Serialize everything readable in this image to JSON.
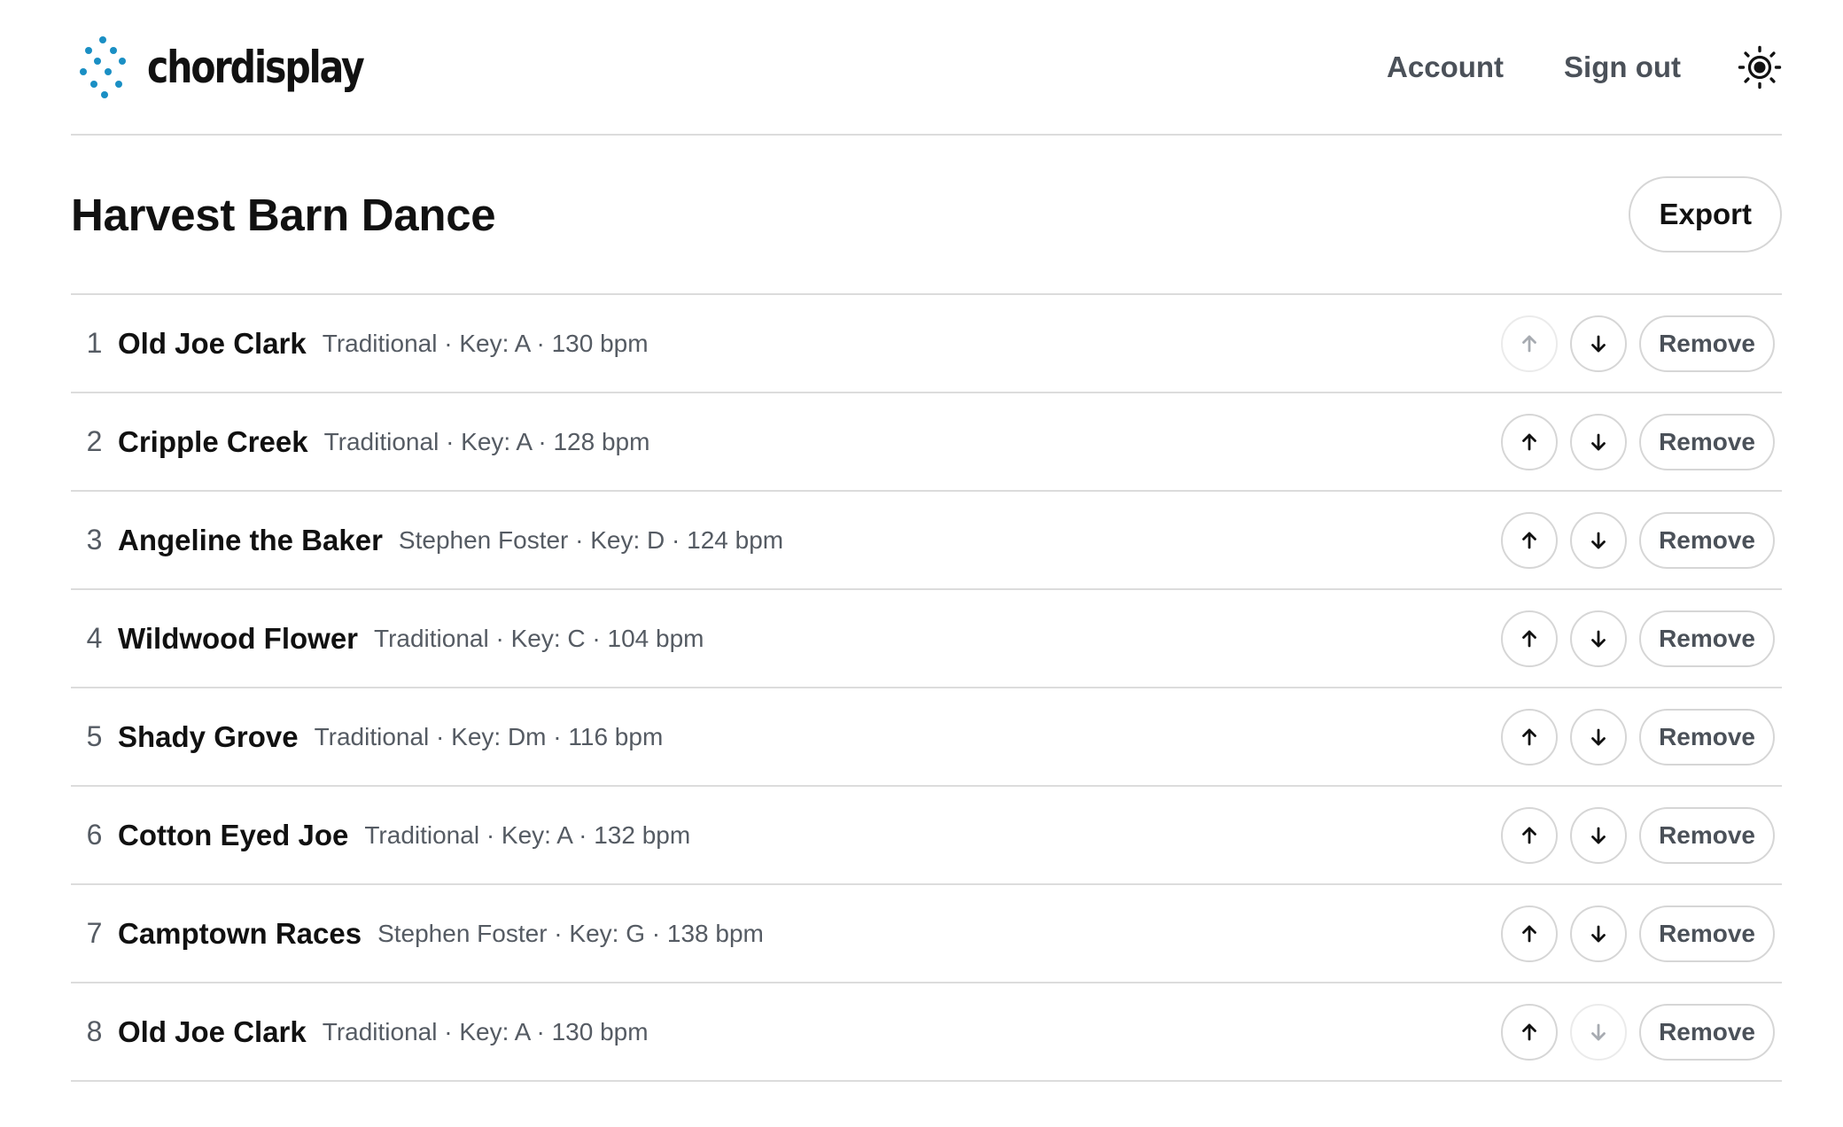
{
  "header": {
    "brand_name": "chordisplay",
    "nav": [
      {
        "label": "Account"
      },
      {
        "label": "Sign out"
      }
    ],
    "theme_toggle_icon": "sun-icon"
  },
  "setlist": {
    "title": "Harvest Barn Dance",
    "export_label": "Export",
    "remove_label": "Remove",
    "songs": [
      {
        "index": "1",
        "title": "Old Joe Clark",
        "meta": "Traditional · Key: A · 130 bpm"
      },
      {
        "index": "2",
        "title": "Cripple Creek",
        "meta": "Traditional · Key: A · 128 bpm"
      },
      {
        "index": "3",
        "title": "Angeline the Baker",
        "meta": "Stephen Foster · Key: D · 124 bpm"
      },
      {
        "index": "4",
        "title": "Wildwood Flower",
        "meta": "Traditional · Key: C · 104 bpm"
      },
      {
        "index": "5",
        "title": "Shady Grove",
        "meta": "Traditional · Key: Dm · 116 bpm"
      },
      {
        "index": "6",
        "title": "Cotton Eyed Joe",
        "meta": "Traditional · Key: A · 132 bpm"
      },
      {
        "index": "7",
        "title": "Camptown Races",
        "meta": "Stephen Foster · Key: G · 138 bpm"
      },
      {
        "index": "8",
        "title": "Old Joe Clark",
        "meta": "Traditional · Key: A · 130 bpm"
      }
    ]
  },
  "colors": {
    "text": "#111111",
    "muted": "#555b63",
    "nav": "#4b5159",
    "border": "#dcdcdc",
    "logo_blue": "#1f6fd1",
    "logo_teal": "#19b7a6"
  }
}
